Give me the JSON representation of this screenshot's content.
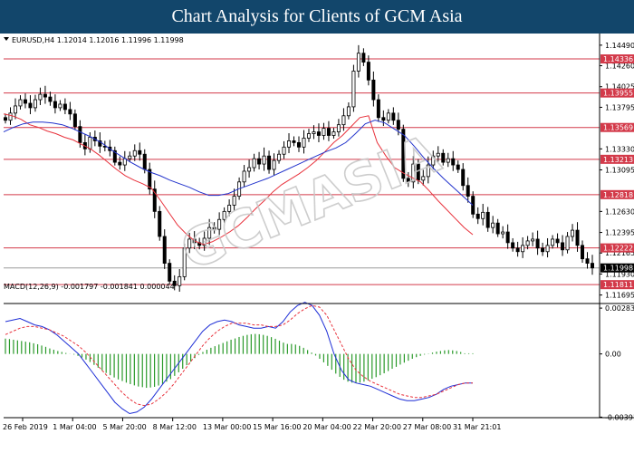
{
  "banner": {
    "title": "Chart Analysis for Clients of GCM Asia"
  },
  "header": {
    "info": "EURUSD,H4  1.12014 1.12016 1.11996 1.11998"
  },
  "macd_label": "MACD(12,26,9) -0.001797 -0.001841 0.000044",
  "watermark": "GCMASIA",
  "colors": {
    "banner": "#12466b",
    "level": "#d33a4a",
    "price_badge": "#000000",
    "ema_fast": "#e8323c",
    "ema_slow": "#2233cc",
    "macd_hist": "#2a9a2a",
    "macd_line": "#1f2fd6",
    "signal_line": "#e8323c"
  },
  "chart_data": [
    {
      "type": "candlestick",
      "title": "EURUSD,H4",
      "symbol": "EURUSD",
      "timeframe": "H4",
      "last_bar": {
        "open": 1.12014,
        "high": 1.12016,
        "low": 1.11996,
        "close": 1.11998
      },
      "current_price": 1.11998,
      "ylim": [
        1.1161,
        1.146
      ],
      "y_ticks": [
        1.1449,
        1.1426,
        1.14025,
        1.13795,
        1.1333,
        1.13095,
        1.1263,
        1.12395,
        1.12165,
        1.1193,
        1.11695
      ],
      "x_ticks": [
        "26 Feb 2019",
        "1 Mar 04:00",
        "5 Mar 20:00",
        "8 Mar 12:00",
        "13 Mar 00:00",
        "15 Mar 16:00",
        "20 Mar 04:00",
        "22 Mar 20:00",
        "27 Mar 08:00",
        "31 Mar 21:01"
      ],
      "horizontal_levels": [
        1.14336,
        1.13955,
        1.13569,
        1.13213,
        1.12818,
        1.12222,
        1.11811
      ],
      "close_series": [
        1.1365,
        1.1373,
        1.1381,
        1.1388,
        1.1384,
        1.1379,
        1.1388,
        1.1394,
        1.1391,
        1.1386,
        1.1379,
        1.1383,
        1.1377,
        1.1372,
        1.1358,
        1.134,
        1.1333,
        1.1346,
        1.1342,
        1.1336,
        1.1335,
        1.1331,
        1.1318,
        1.1315,
        1.1322,
        1.1325,
        1.1331,
        1.1327,
        1.131,
        1.1288,
        1.1263,
        1.1235,
        1.1205,
        1.1185,
        1.118,
        1.119,
        1.1222,
        1.1232,
        1.1228,
        1.1225,
        1.1233,
        1.1245,
        1.1243,
        1.1254,
        1.1263,
        1.127,
        1.128,
        1.1296,
        1.1308,
        1.1312,
        1.1322,
        1.1316,
        1.1325,
        1.131,
        1.132,
        1.1327,
        1.1335,
        1.1342,
        1.134,
        1.1335,
        1.1345,
        1.135,
        1.1352,
        1.1348,
        1.1356,
        1.1348,
        1.1352,
        1.136,
        1.137,
        1.138,
        1.142,
        1.144,
        1.143,
        1.141,
        1.1388,
        1.1368,
        1.1365,
        1.1373,
        1.1365,
        1.1355,
        1.13,
        1.1296,
        1.1316,
        1.1298,
        1.1302,
        1.1315,
        1.1325,
        1.1328,
        1.1318,
        1.1322,
        1.1315,
        1.131,
        1.1292,
        1.128,
        1.126,
        1.1255,
        1.1262,
        1.1245,
        1.125,
        1.1238,
        1.124,
        1.1228,
        1.1222,
        1.1218,
        1.1225,
        1.123,
        1.1232,
        1.1222,
        1.1218,
        1.1225,
        1.1232,
        1.1228,
        1.122,
        1.1235,
        1.1242,
        1.1225,
        1.121,
        1.1205,
        1.11998
      ],
      "series": [
        {
          "values": [
            1.1372,
            1.137,
            1.1366,
            1.136,
            1.1357,
            1.1353,
            1.135,
            1.1346,
            1.1343,
            1.1338,
            1.1333,
            1.1326,
            1.1318,
            1.131,
            1.1303,
            1.1298,
            1.1294,
            1.1289,
            1.1276,
            1.1262,
            1.1248,
            1.1238,
            1.123,
            1.1226,
            1.1229,
            1.1234,
            1.124,
            1.1247,
            1.1256,
            1.1266,
            1.1275,
            1.1285,
            1.1293,
            1.1299,
            1.1305,
            1.1312,
            1.132,
            1.133,
            1.134,
            1.1348,
            1.1358,
            1.1368,
            1.137,
            1.134,
            1.1325,
            1.1312,
            1.1306,
            1.1301,
            1.1296,
            1.1286,
            1.1275,
            1.1265,
            1.1255,
            1.1245,
            1.1237
          ]
        },
        {
          "values": [
            1.1352,
            1.1357,
            1.1361,
            1.1363,
            1.1363,
            1.1362,
            1.136,
            1.1356,
            1.1351,
            1.1346,
            1.134,
            1.1332,
            1.1325,
            1.1318,
            1.1312,
            1.1307,
            1.1303,
            1.1298,
            1.1294,
            1.129,
            1.1285,
            1.1281,
            1.1281,
            1.1283,
            1.1288,
            1.1292,
            1.1296,
            1.13,
            1.1305,
            1.131,
            1.1315,
            1.132,
            1.1325,
            1.133,
            1.1334,
            1.134,
            1.135,
            1.1361,
            1.1365,
            1.1362,
            1.1355,
            1.1348,
            1.1336,
            1.1323,
            1.1311,
            1.13,
            1.129,
            1.128,
            1.127
          ]
        }
      ]
    },
    {
      "type": "line",
      "title": "MACD(12,26,9) -0.001797 -0.001841 0.000044",
      "ylim": [
        -0.00395,
        0.0029
      ],
      "y_ticks": [
        0.002839,
        0.0,
        -0.003916
      ],
      "histogram": [
        0.00095,
        0.00092,
        0.00088,
        0.00084,
        0.0008,
        0.00076,
        0.00072,
        0.00066,
        0.0006,
        0.00052,
        0.00044,
        0.00034,
        0.00026,
        0.00018,
        0.00012,
        6e-05,
        1e-05,
        -4e-05,
        -0.00012,
        -0.00022,
        -0.00035,
        -0.0005,
        -0.00068,
        -0.00085,
        -0.00102,
        -0.00118,
        -0.00132,
        -0.00146,
        -0.00158,
        -0.00168,
        -0.00178,
        -0.00187,
        -0.00195,
        -0.00202,
        -0.00206,
        -0.0021,
        -0.00208,
        -0.00204,
        -0.00196,
        -0.00186,
        -0.00172,
        -0.00156,
        -0.00136,
        -0.00114,
        -0.00092,
        -0.0007,
        -0.00048,
        -0.00026,
        -6e-05,
        0.00012,
        0.00026,
        0.00038,
        0.00048,
        0.00058,
        0.00068,
        0.00078,
        0.00088,
        0.00096,
        0.00105,
        0.00112,
        0.00118,
        0.00122,
        0.00124,
        0.00122,
        0.00118,
        0.00112,
        0.00104,
        0.00094,
        0.00082,
        0.0007,
        0.00062,
        0.00062,
        0.00058,
        0.0005,
        0.00038,
        0.00024,
        8e-05,
        -0.0001,
        -0.0003,
        -0.00052,
        -0.00074,
        -0.00098,
        -0.00122,
        -0.00142,
        -0.0016,
        -0.00172,
        -0.00178,
        -0.0018,
        -0.00178,
        -0.00172,
        -0.00164,
        -0.00154,
        -0.00144,
        -0.00132,
        -0.0012,
        -0.00106,
        -0.00092,
        -0.0008,
        -0.00066,
        -0.00054,
        -0.00042,
        -0.0003,
        -0.0002,
        -0.00012,
        -4e-05,
        2e-05,
        8e-05,
        0.00014,
        0.00018,
        0.00022,
        0.00024,
        0.00022,
        0.00018,
        0.00012,
        4e-05,
        4e-05,
        4e-05
      ],
      "series": [
        {
          "values": [
            0.002,
            0.0021,
            0.0022,
            0.002,
            0.0018,
            0.0017,
            0.0015,
            0.0012,
            0.0008,
            0.0004,
            0.0,
            -0.0006,
            -0.0012,
            -0.0018,
            -0.0024,
            -0.003,
            -0.0034,
            -0.0037,
            -0.0036,
            -0.0033,
            -0.0028,
            -0.0022,
            -0.0016,
            -0.001,
            -0.0004,
            0.0002,
            0.0008,
            0.0014,
            0.0018,
            0.002,
            0.0021,
            0.002,
            0.0018,
            0.0017,
            0.0016,
            0.0016,
            0.0017,
            0.0016,
            0.002,
            0.0026,
            0.003,
            0.0032,
            0.003,
            0.0024,
            0.0014,
            0.0,
            -0.001,
            -0.0016,
            -0.0018,
            -0.0019,
            -0.002,
            -0.0022,
            -0.0024,
            -0.0026,
            -0.0028,
            -0.0029,
            -0.0029,
            -0.0028,
            -0.0027,
            -0.0025,
            -0.0022,
            -0.002,
            -0.0019,
            -0.0018,
            -0.0018
          ]
        },
        {
          "values": [
            0.0012,
            0.0014,
            0.0016,
            0.0017,
            0.0017,
            0.0016,
            0.0015,
            0.0013,
            0.0011,
            0.0008,
            0.0005,
            0.0001,
            -0.0004,
            -0.0009,
            -0.0014,
            -0.0019,
            -0.0024,
            -0.0028,
            -0.0031,
            -0.0032,
            -0.0031,
            -0.0028,
            -0.0024,
            -0.0019,
            -0.0013,
            -0.0007,
            -0.0001,
            0.0005,
            0.001,
            0.0014,
            0.0017,
            0.0019,
            0.0019,
            0.0019,
            0.0018,
            0.0018,
            0.0017,
            0.0017,
            0.0018,
            0.0021,
            0.0025,
            0.0028,
            0.003,
            0.0029,
            0.0024,
            0.0015,
            0.0006,
            -0.0003,
            -0.001,
            -0.0014,
            -0.0017,
            -0.0019,
            -0.0021,
            -0.0023,
            -0.0025,
            -0.0026,
            -0.0027,
            -0.0027,
            -0.0026,
            -0.0025,
            -0.0023,
            -0.0021,
            -0.0019,
            -0.0018,
            -0.0018
          ]
        }
      ]
    }
  ]
}
